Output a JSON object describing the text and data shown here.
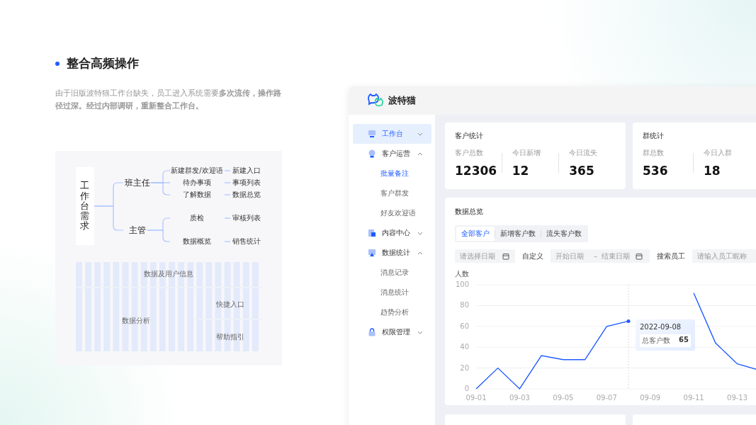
{
  "section": {
    "title": "整合高频操作",
    "description": "由于旧版波特猫工作台缺失，员工进入系统需要**多次流传，操作路径过深。经过内部调研，重新整合工作台。**"
  },
  "mind_map": {
    "root": "工作台需求",
    "children": [
      {
        "label": "班主任",
        "children": [
          {
            "label": "新建群发/欢迎语",
            "children": [
              {
                "label": "新建入口"
              }
            ]
          },
          {
            "label": "待办事项",
            "children": [
              {
                "label": "事项列表"
              }
            ]
          },
          {
            "label": "了解数据",
            "children": [
              {
                "label": "数据总览"
              }
            ]
          }
        ]
      },
      {
        "label": "主管",
        "children": [
          {
            "label": "质检",
            "children": [
              {
                "label": "审核列表"
              }
            ]
          },
          {
            "label": "数据概览",
            "children": [
              {
                "label": "销售统计"
              }
            ]
          }
        ]
      }
    ]
  },
  "layout_grid": {
    "areas": [
      "数据及用户信息",
      "数据分析",
      "快捷入口",
      "帮助指引"
    ]
  },
  "app": {
    "brand": "波特猫",
    "sidebar": {
      "items": [
        {
          "label": "工作台",
          "selected": true,
          "expanded": false
        },
        {
          "label": "客户运营",
          "selected": false,
          "expanded": true,
          "children": [
            {
              "label": "批量备注",
              "selected": true
            },
            {
              "label": "客户群发",
              "selected": false
            },
            {
              "label": "好友欢迎语",
              "selected": false
            }
          ]
        },
        {
          "label": "内容中心",
          "selected": false,
          "expanded": false
        },
        {
          "label": "数据统计",
          "selected": false,
          "expanded": true,
          "children": [
            {
              "label": "消息记录",
              "selected": false
            },
            {
              "label": "消息统计",
              "selected": false
            },
            {
              "label": "趋势分析",
              "selected": false
            }
          ]
        },
        {
          "label": "权限管理",
          "selected": false,
          "expanded": false
        }
      ]
    },
    "stat_cards": [
      {
        "title": "客户统计",
        "stats": [
          {
            "label": "客户总数",
            "value": "12306"
          },
          {
            "label": "今日新增",
            "value": "12"
          },
          {
            "label": "今日流失",
            "value": "365"
          }
        ]
      },
      {
        "title": "群统计",
        "stats": [
          {
            "label": "群总数",
            "value": "536"
          },
          {
            "label": "今日入群",
            "value": "18"
          }
        ]
      }
    ],
    "data_overview": {
      "title": "数据总览",
      "tabs": [
        {
          "label": "全部客户",
          "selected": true
        },
        {
          "label": "新增客户数",
          "selected": false
        },
        {
          "label": "流失客户数",
          "selected": false
        }
      ],
      "date_field": {
        "placeholder": "请选择日期"
      },
      "custom_label": "自定义",
      "range": {
        "start_placeholder": "开始日期",
        "separator": "–",
        "end_placeholder": "结束日期"
      },
      "search_label": "搜索员工",
      "search_field": {
        "placeholder": "请输入员工昵称"
      },
      "chart_data": {
        "type": "line",
        "ylabel": "人数",
        "categories": [
          "09-01",
          null,
          "09-03",
          null,
          "09-05",
          null,
          "09-07",
          null,
          "09-09",
          null,
          "09-11",
          null,
          "09-13",
          null
        ],
        "series": [
          {
            "name": "总客户数",
            "color": "#1f5cff",
            "values": [
              0,
              20,
              0,
              32,
              28,
              28,
              60,
              65,
              null,
              null,
              92,
              44,
              24,
              18
            ]
          }
        ],
        "ylim": [
          0,
          100
        ],
        "yticks": [
          0,
          20,
          40,
          60,
          80,
          100
        ],
        "grid": true
      },
      "tooltip": {
        "date": "2022-09-08",
        "value": "65"
      }
    }
  }
}
